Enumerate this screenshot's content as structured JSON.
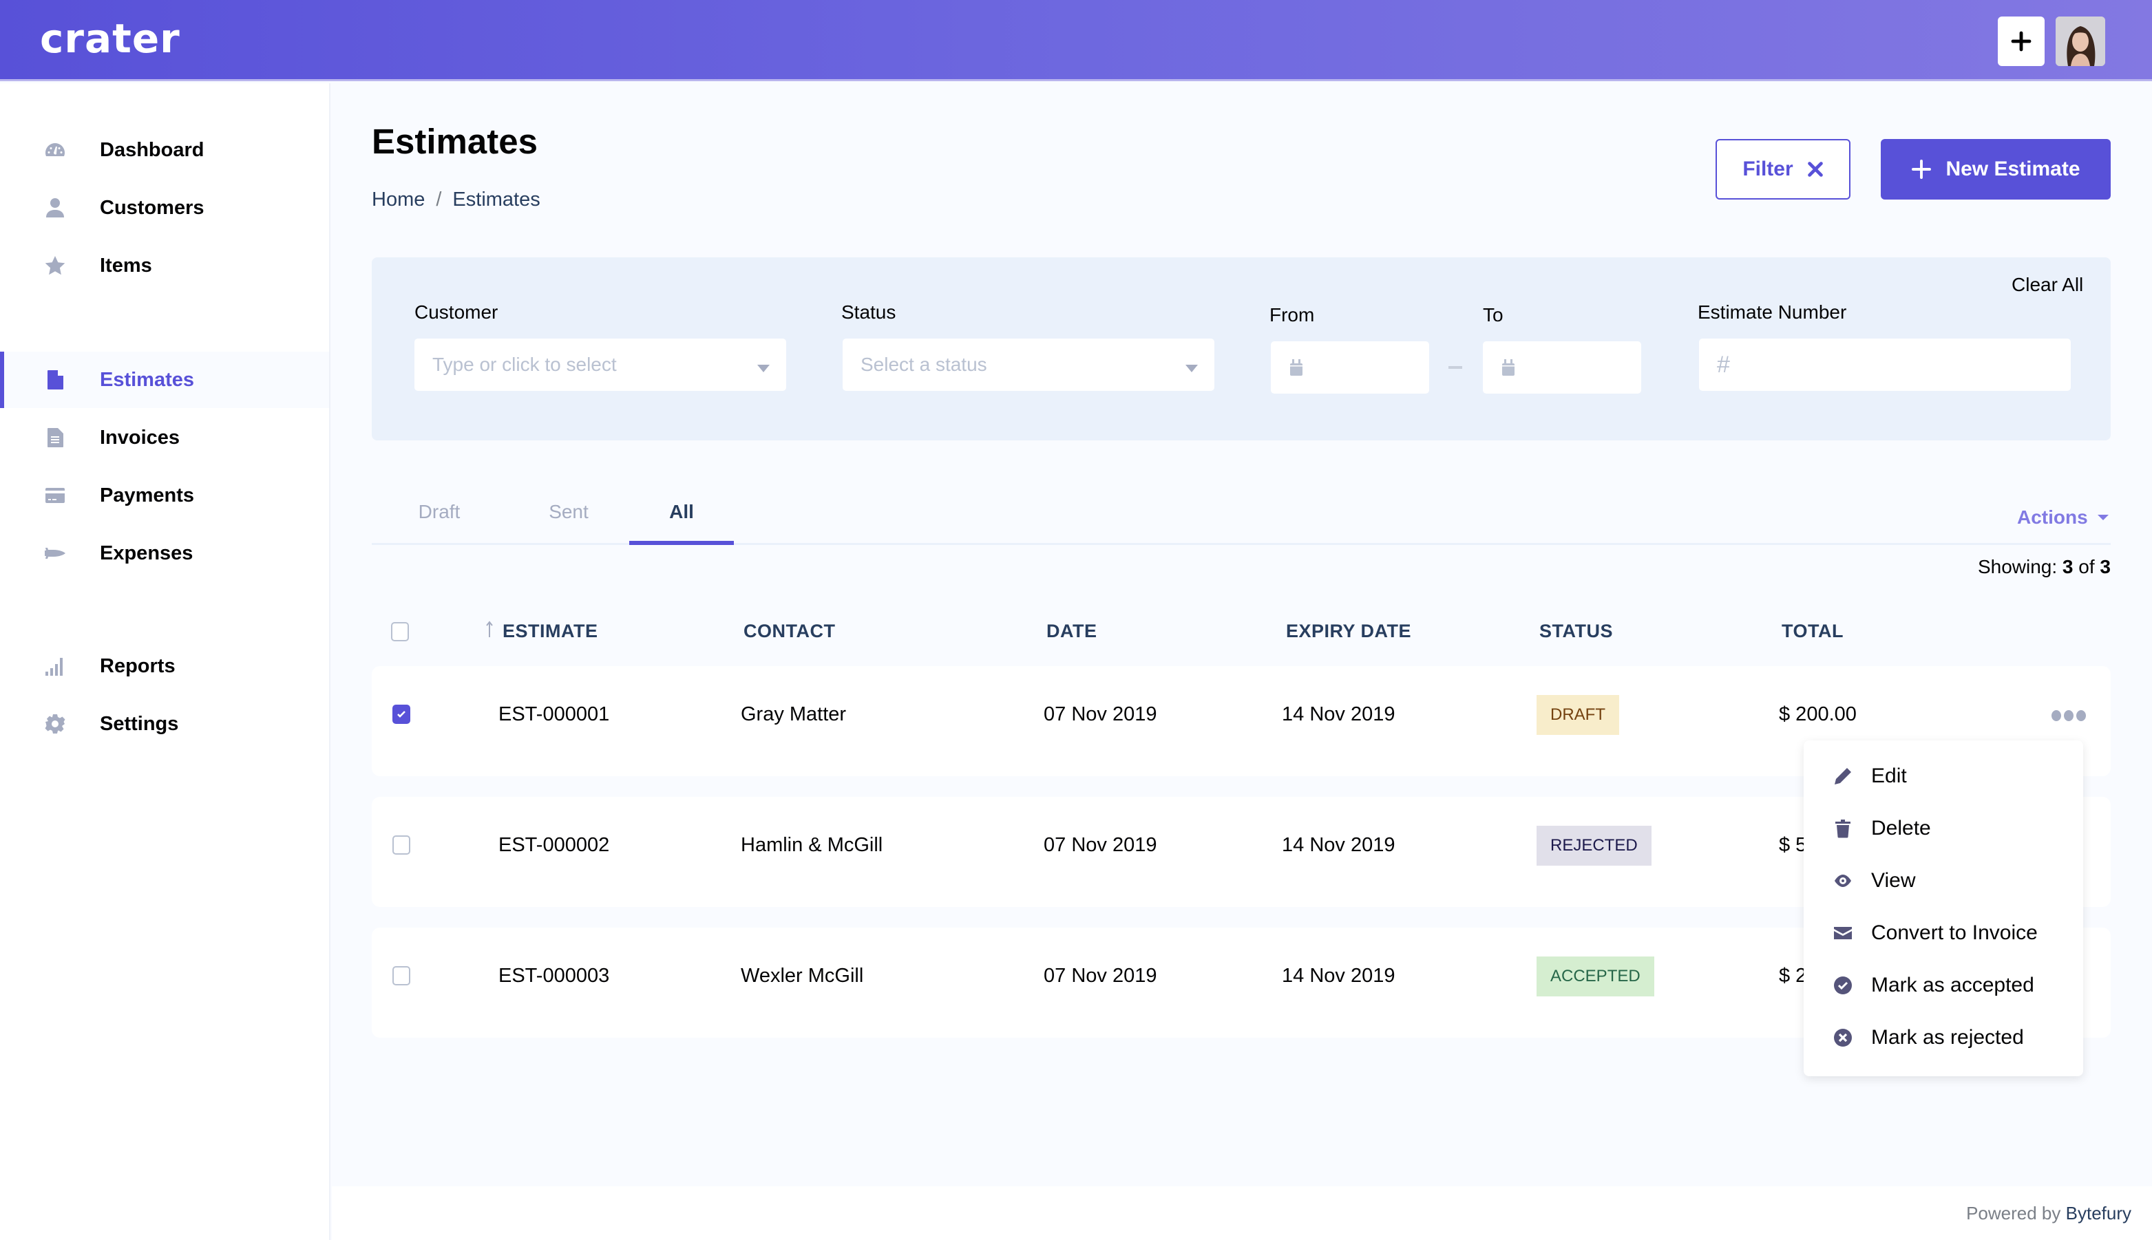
{
  "app": {
    "logo_text": "crater"
  },
  "header": {
    "add_button_icon": "plus-icon",
    "avatar_alt": "user avatar"
  },
  "sidebar": {
    "items": [
      {
        "label": "Dashboard",
        "icon": "dashboard-gauge-icon",
        "active": false
      },
      {
        "label": "Customers",
        "icon": "user-icon",
        "active": false
      },
      {
        "label": "Items",
        "icon": "star-icon",
        "active": false
      },
      {
        "label": "Estimates",
        "icon": "file-icon",
        "active": true
      },
      {
        "label": "Invoices",
        "icon": "file-text-icon",
        "active": false
      },
      {
        "label": "Payments",
        "icon": "credit-card-icon",
        "active": false
      },
      {
        "label": "Expenses",
        "icon": "space-shuttle-icon",
        "active": false
      },
      {
        "label": "Reports",
        "icon": "signal-icon",
        "active": false
      },
      {
        "label": "Settings",
        "icon": "cog-icon",
        "active": false
      }
    ]
  },
  "page": {
    "title": "Estimates",
    "breadcrumb": [
      "Home",
      "Estimates"
    ],
    "breadcrumb_separator": "/",
    "filter_button": "Filter",
    "new_button": "New Estimate"
  },
  "filters": {
    "customer": {
      "label": "Customer",
      "placeholder": "Type or click to select",
      "value": ""
    },
    "status": {
      "label": "Status",
      "placeholder": "Select a status",
      "value": ""
    },
    "from": {
      "label": "From",
      "value": ""
    },
    "to": {
      "label": "To",
      "value": ""
    },
    "estimate_number": {
      "label": "Estimate Number",
      "prefix": "#",
      "value": ""
    },
    "clear_all": "Clear All"
  },
  "tabs": [
    {
      "label": "Draft",
      "active": false
    },
    {
      "label": "Sent",
      "active": false
    },
    {
      "label": "All",
      "active": true
    }
  ],
  "actions_label": "Actions",
  "showing": {
    "prefix": "Showing:",
    "count": "3",
    "of": "of",
    "total": "3"
  },
  "table": {
    "columns": [
      "ESTIMATE",
      "CONTACT",
      "DATE",
      "EXPIRY DATE",
      "STATUS",
      "TOTAL"
    ],
    "rows": [
      {
        "checked": true,
        "estimate": "EST-000001",
        "contact": "Gray Matter",
        "date": "07 Nov 2019",
        "expiry": "14 Nov 2019",
        "status": "DRAFT",
        "total": "$ 200.00"
      },
      {
        "checked": false,
        "estimate": "EST-000002",
        "contact": "Hamlin & McGill",
        "date": "07 Nov 2019",
        "expiry": "14 Nov 2019",
        "status": "REJECTED",
        "total": "$ 5"
      },
      {
        "checked": false,
        "estimate": "EST-000003",
        "contact": "Wexler McGill",
        "date": "07 Nov 2019",
        "expiry": "14 Nov 2019",
        "status": "ACCEPTED",
        "total": "$ 2"
      }
    ]
  },
  "status_colors": {
    "DRAFT": {
      "bg": "#f8edcb",
      "fg": "#744210"
    },
    "REJECTED": {
      "bg": "#e1e0ea",
      "fg": "#1d1a4c"
    },
    "ACCEPTED": {
      "bg": "#d5eed0",
      "fg": "#276749"
    }
  },
  "row_menu": {
    "items": [
      {
        "label": "Edit",
        "icon": "pencil-icon"
      },
      {
        "label": "Delete",
        "icon": "trash-icon"
      },
      {
        "label": "View",
        "icon": "eye-icon"
      },
      {
        "label": "Convert to Invoice",
        "icon": "envelope-icon"
      },
      {
        "label": "Mark as accepted",
        "icon": "check-circle-icon"
      },
      {
        "label": "Mark as rejected",
        "icon": "times-circle-icon"
      }
    ]
  },
  "footer": {
    "prefix": "Powered by",
    "brand": "Bytefury"
  },
  "colors": {
    "primary": "#5851d8",
    "text": "#040405",
    "muted": "#a5acc1",
    "heading": "#283e5f"
  }
}
